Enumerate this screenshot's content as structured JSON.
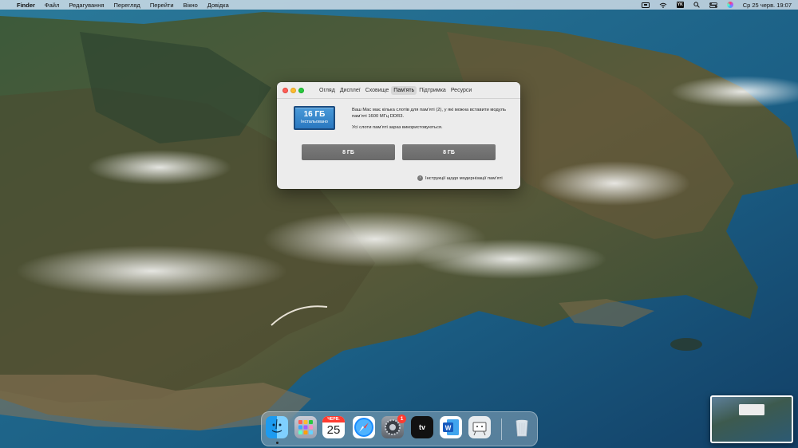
{
  "menubar": {
    "apple_symbol": "",
    "app_name": "Finder",
    "menus": [
      "Файл",
      "Редагування",
      "Перегляд",
      "Перейти",
      "Вікно",
      "Довідка"
    ],
    "status_icons": [
      "display-icon",
      "wifi-icon",
      "keyboard-layout-icon",
      "search-icon",
      "control-center-icon",
      "siri-icon"
    ],
    "keyboard_layout": "YK",
    "datetime": "Ср 25 черв.  19:07"
  },
  "window": {
    "tabs": [
      "Огляд",
      "Дисплеї",
      "Сховище",
      "Пам’ять",
      "Підтримка",
      "Ресурси"
    ],
    "active_tab": "Пам’ять",
    "ram_total": "16 ГБ",
    "ram_status": "Інстальовано",
    "info_line1": "Ваш Mac має кілька слотів для пам’яті (2), у які можна вставити модуль пам’яті 1600 МГц DDR3.",
    "info_line2": "Усі слоти пам’яті зараз використовуються.",
    "slots": [
      "8 ГБ",
      "8 ГБ"
    ],
    "upgrade_link": "Інструкції щодо модернізації пам’яті"
  },
  "dock": {
    "apps": [
      "finder-icon",
      "launchpad-icon",
      "calendar-icon",
      "safari-icon",
      "system-preferences-icon",
      "apple-tv-icon",
      "microsoft-word-icon",
      "migration-assistant-icon",
      "trash-icon"
    ],
    "calendar_month": "ЧЕРВ.",
    "calendar_day": "25",
    "prefs_badge": "1",
    "appletv_label": "tv"
  },
  "colors": {
    "ram_badge": "#2a78c0",
    "slot": "#737373",
    "badge": "#ff3b30"
  }
}
